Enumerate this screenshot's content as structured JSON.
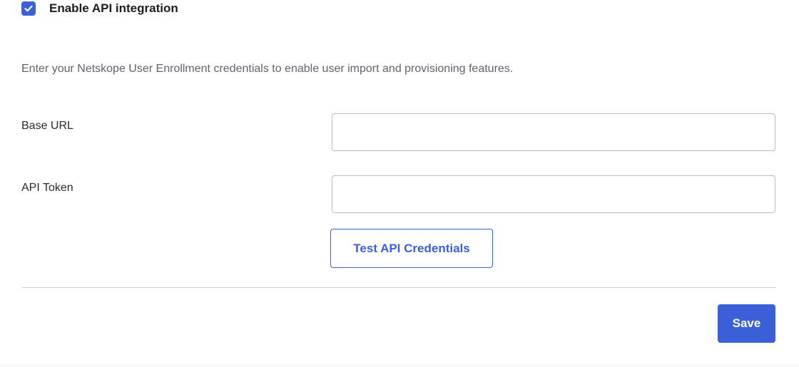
{
  "api_integration": {
    "checkbox_checked": true,
    "label": "Enable API integration"
  },
  "description": "Enter your Netskope User Enrollment credentials to enable user import and provisioning features.",
  "form": {
    "base_url_label": "Base URL",
    "base_url_value": "",
    "api_token_label": "API Token",
    "api_token_value": "",
    "test_button_label": "Test API Credentials"
  },
  "footer": {
    "save_label": "Save"
  },
  "colors": {
    "accent": "#3a5fd7",
    "muted_text": "#5f6370",
    "input_border": "#b8bcc5"
  }
}
